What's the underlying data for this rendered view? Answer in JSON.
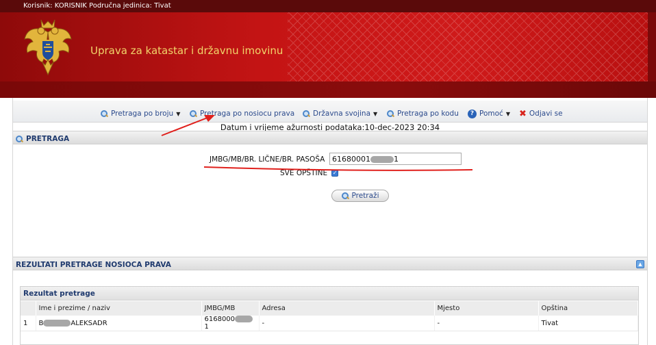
{
  "header": {
    "user_info": "Korisnik: KORISNIK Područna jedinica: Tivat",
    "title": "Uprava za katastar i državnu imovinu"
  },
  "menu": {
    "items": [
      {
        "label": "Pretraga po broju",
        "icon": "search-icon",
        "dropdown": true
      },
      {
        "label": "Pretraga po nosiocu prava",
        "icon": "search-icon",
        "dropdown": false
      },
      {
        "label": "Državna svojina",
        "icon": "search-icon",
        "dropdown": true
      },
      {
        "label": "Pretraga po kodu",
        "icon": "search-icon",
        "dropdown": false
      },
      {
        "label": "Pomoć",
        "icon": "help-icon",
        "dropdown": true
      },
      {
        "label": "Odjavi se",
        "icon": "close-icon",
        "dropdown": false
      }
    ]
  },
  "datum": "Datum i vrijeme ažurnosti podataka:10-dec-2023 20:34",
  "search_panel": {
    "title": "PRETRAGA",
    "field_label": "JMBG/MB/BR. LIČNE/BR. PASOŠA",
    "field_value_prefix": "61680001",
    "field_value_suffix": "1",
    "checkbox_label": "SVE OPŠTINE",
    "checkbox_checked": true,
    "button_label": "Pretraži"
  },
  "results_panel": {
    "title": "REZULTATI PRETRAGE NOSIOCA PRAVA",
    "box_title": "Rezultat pretrage",
    "columns": [
      "",
      "Ime i prezime / naziv",
      "JMBG/MB",
      "Adresa",
      "Mjesto",
      "Opština"
    ],
    "rows": [
      {
        "num": "1",
        "name_prefix": "B",
        "name_suffix": "ALEKSADR",
        "jmbg_prefix": "6168000",
        "jmbg_suffix": "1",
        "adresa": "-",
        "mjesto": "-",
        "opstina": "Tivat"
      }
    ]
  },
  "colors": {
    "banner_red": "#c41414",
    "title_gold": "#f1d46a",
    "link_blue": "#2b4a8c",
    "annotation_red": "#e0201c"
  }
}
